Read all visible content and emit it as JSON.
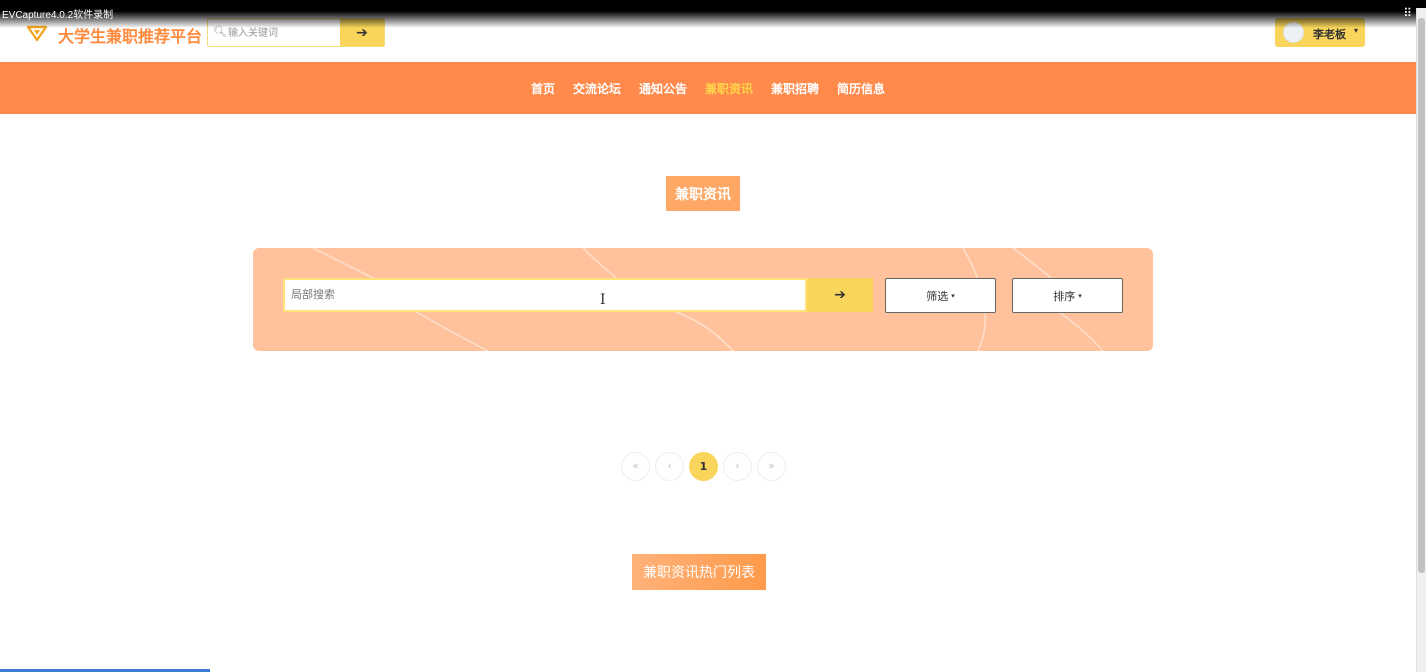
{
  "capture": {
    "title": "EVCapture4.0.2软件录制"
  },
  "header": {
    "site_title": "大学生兼职推荐平台",
    "search_placeholder": "输入关键词",
    "search_button": "➔",
    "user_name": "李老板",
    "user_caret": "▾"
  },
  "nav": {
    "items": [
      {
        "label": "首页"
      },
      {
        "label": "交流论坛"
      },
      {
        "label": "通知公告"
      },
      {
        "label": "兼职资讯",
        "active": true
      },
      {
        "label": "兼职招聘"
      },
      {
        "label": "简历信息"
      }
    ]
  },
  "main": {
    "section_title": "兼职资讯",
    "local_search_placeholder": "局部搜索",
    "local_search_button": "➔",
    "filter_label": "筛选",
    "sort_label": "排序",
    "caret": "▾",
    "pagination": {
      "first": "«",
      "prev": "‹",
      "current": "1",
      "next": "›",
      "last": "»"
    },
    "hot_title": "兼职资讯热门列表"
  },
  "colors": {
    "brand_orange": "#ff8a4c",
    "accent_yellow": "#f9d65b",
    "active_nav": "#ffd54a",
    "panel_bg": "#ffc29d"
  }
}
